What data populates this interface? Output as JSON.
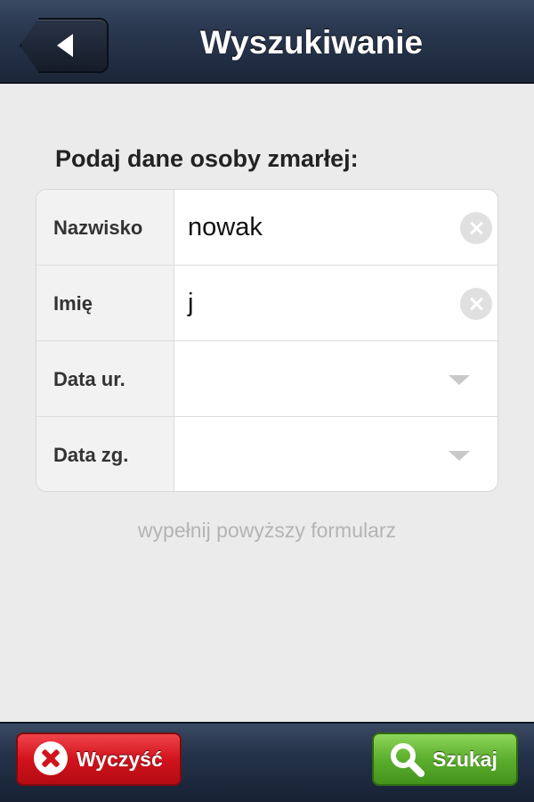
{
  "header": {
    "title": "Wyszukiwanie"
  },
  "form": {
    "prompt": "Podaj dane osoby zmarłej:",
    "fields": [
      {
        "label": "Nazwisko",
        "value": "nowak",
        "control": "clear-icon"
      },
      {
        "label": "Imię",
        "value": "j",
        "control": "clear-icon"
      },
      {
        "label": "Data ur.",
        "value": "",
        "control": "dropdown-icon"
      },
      {
        "label": "Data zg.",
        "value": "",
        "control": "dropdown-icon"
      }
    ],
    "hint": "wypełnij powyższy formularz"
  },
  "footer": {
    "clear_label": "Wyczyść",
    "search_label": "Szukaj"
  },
  "colors": {
    "header": "#24324a",
    "clear_button": "#d1131c",
    "search_button": "#5cae2d",
    "background": "#ebebeb"
  },
  "icons": {
    "back": "back-arrow-icon",
    "clear_field": "clear-icon",
    "dropdown": "chevron-down-icon",
    "clear_button": "x-circle-icon",
    "search_button": "search-icon"
  }
}
